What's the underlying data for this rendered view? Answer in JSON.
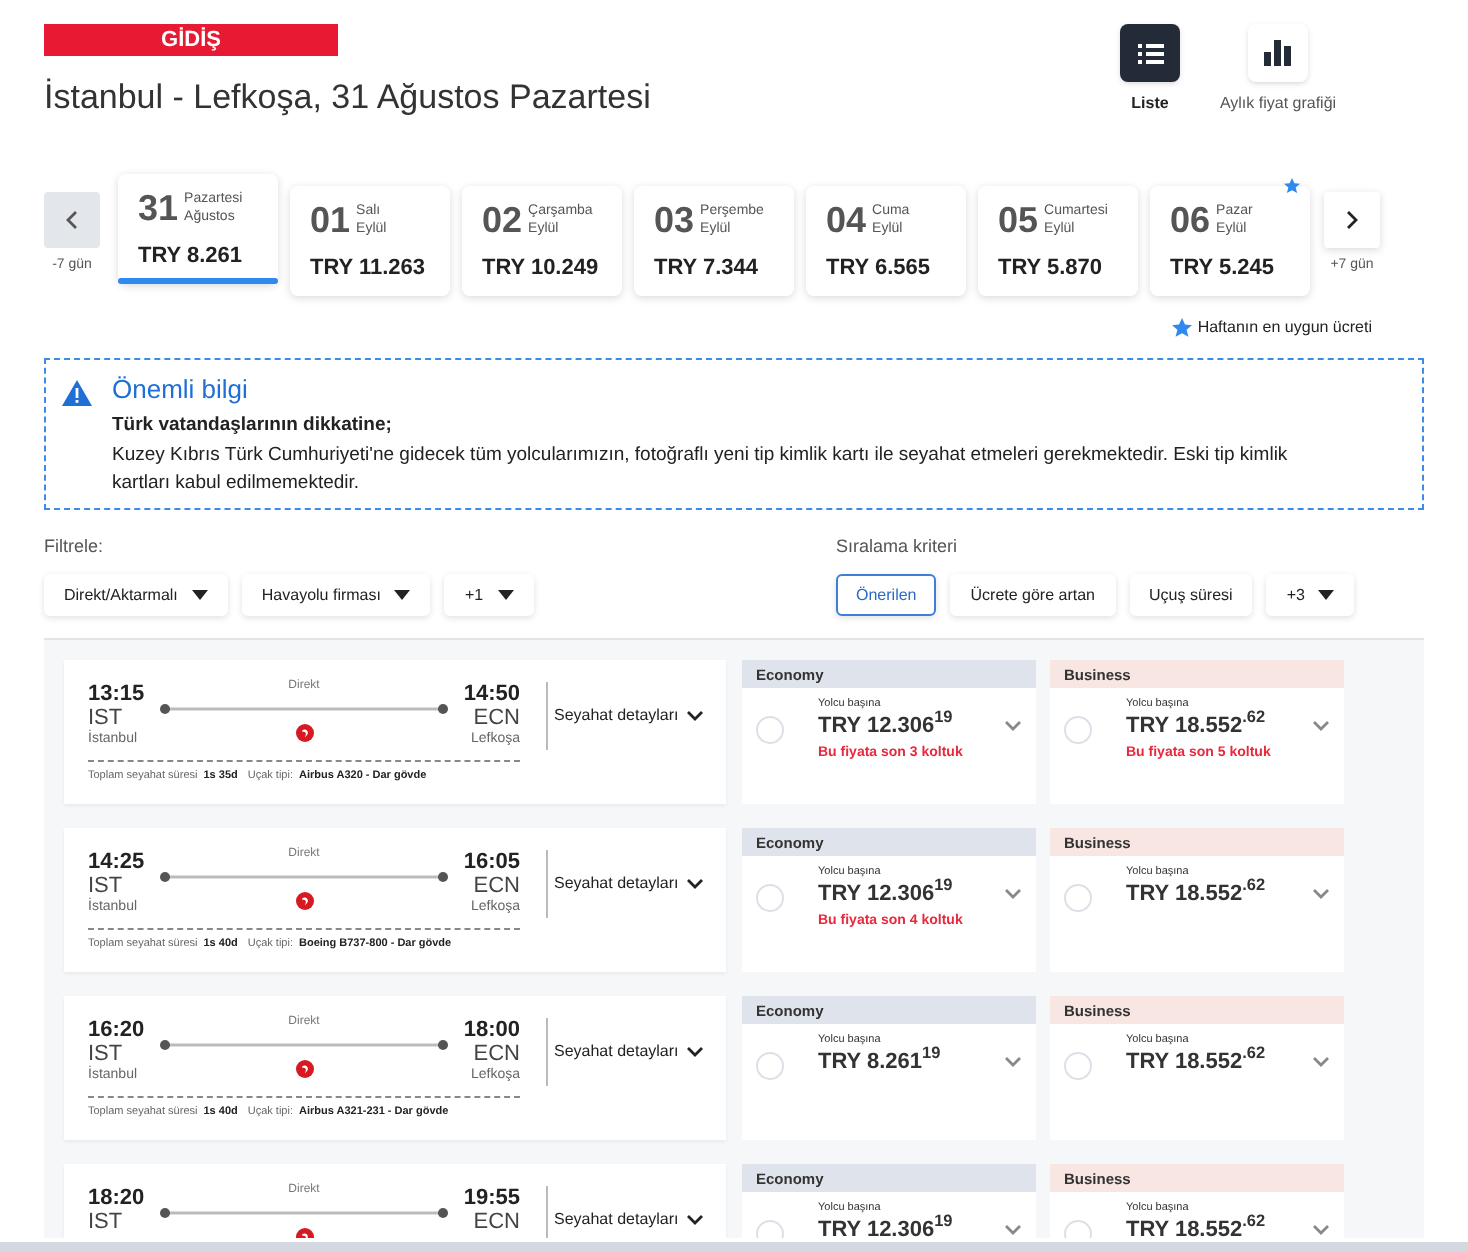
{
  "direction_label": "GİDİŞ",
  "title": "İstanbul - Lefkoşa, 31 Ağustos Pazartesi",
  "view_options": [
    {
      "label": "Liste",
      "kind": "list",
      "selected": true
    },
    {
      "label": "Aylık fiyat grafiği",
      "kind": "chart",
      "selected": false
    }
  ],
  "date_strip": {
    "prev_label": "-7 gün",
    "next_label": "+7 gün",
    "days": [
      {
        "day": "31",
        "weekday": "Pazartesi",
        "month": "Ağustos",
        "price": "TRY 8.261",
        "selected": true,
        "cheapest": false
      },
      {
        "day": "01",
        "weekday": "Salı",
        "month": "Eylül",
        "price": "TRY 11.263",
        "selected": false,
        "cheapest": false
      },
      {
        "day": "02",
        "weekday": "Çarşamba",
        "month": "Eylül",
        "price": "TRY 10.249",
        "selected": false,
        "cheapest": false
      },
      {
        "day": "03",
        "weekday": "Perşembe",
        "month": "Eylül",
        "price": "TRY 7.344",
        "selected": false,
        "cheapest": false
      },
      {
        "day": "04",
        "weekday": "Cuma",
        "month": "Eylül",
        "price": "TRY 6.565",
        "selected": false,
        "cheapest": false
      },
      {
        "day": "05",
        "weekday": "Cumartesi",
        "month": "Eylül",
        "price": "TRY 5.870",
        "selected": false,
        "cheapest": false
      },
      {
        "day": "06",
        "weekday": "Pazar",
        "month": "Eylül",
        "price": "TRY 5.245",
        "selected": false,
        "cheapest": true
      }
    ]
  },
  "cheapest_legend": "Haftanın en uygun ücreti",
  "notice": {
    "title": "Önemli bilgi",
    "subtitle": "Türk vatandaşlarının dikkatine;",
    "text": "Kuzey Kıbrıs Türk Cumhuriyeti'ne gidecek tüm yolcularımızın, fotoğraflı yeni tip kimlik kartı ile seyahat etmeleri gerekmektedir. Eski tip kimlik kartları kabul edilmemektedir."
  },
  "filters": {
    "label": "Filtrele:",
    "options": [
      "Direkt/Aktarmalı",
      "Havayolu firması",
      "+1"
    ]
  },
  "sort": {
    "label": "Sıralama kriteri",
    "options": [
      {
        "label": "Önerilen",
        "kind": "button",
        "selected": true
      },
      {
        "label": "Ücrete göre artan",
        "kind": "button",
        "selected": false
      },
      {
        "label": "Uçuş süresi",
        "kind": "button",
        "selected": false
      },
      {
        "label": "+3",
        "kind": "dropdown",
        "selected": false
      }
    ]
  },
  "flights": [
    {
      "departure_time": "13:15",
      "departure_code": "IST",
      "departure_city": "İstanbul",
      "arrival_time": "14:50",
      "arrival_code": "ECN",
      "arrival_city": "Lefkoşa",
      "stops": "Direkt",
      "details_label": "Seyahat detayları",
      "duration_label": "Toplam seyahat süresi",
      "duration": "1s 35d",
      "aircraft_label": "Uçak tipi:",
      "aircraft": "Airbus A320 - Dar gövde",
      "fares": [
        {
          "cabin": "Economy",
          "kind": "economy",
          "per_person": "Yolcu başına",
          "price": "TRY 12.306$^{19}$",
          "seats_note": "Bu fiyata son 3 koltuk",
          "selected": false
        },
        {
          "cabin": "Business",
          "kind": "business",
          "per_person": "Yolcu başına",
          "price": "TRY 18.552$^{.62}$",
          "seats_note": "Bu fiyata son 5 koltuk",
          "selected": false
        }
      ]
    },
    {
      "departure_time": "14:25",
      "departure_code": "IST",
      "departure_city": "İstanbul",
      "arrival_time": "16:05",
      "arrival_code": "ECN",
      "arrival_city": "Lefkoşa",
      "stops": "Direkt",
      "details_label": "Seyahat detayları",
      "duration_label": "Toplam seyahat süresi",
      "duration": "1s 40d",
      "aircraft_label": "Uçak tipi:",
      "aircraft": "Boeing B737-800 - Dar gövde",
      "fares": [
        {
          "cabin": "Economy",
          "kind": "economy",
          "per_person": "Yolcu başına",
          "price": "TRY 12.306$^{19}$",
          "seats_note": "Bu fiyata son 4 koltuk",
          "selected": false
        },
        {
          "cabin": "Business",
          "kind": "business",
          "per_person": "Yolcu başına",
          "price": "TRY 18.552$^{.62}$",
          "selected": false
        }
      ]
    },
    {
      "departure_time": "16:20",
      "departure_code": "IST",
      "departure_city": "İstanbul",
      "arrival_time": "18:00",
      "arrival_code": "ECN",
      "arrival_city": "Lefkoşa",
      "stops": "Direkt",
      "details_label": "Seyahat detayları",
      "duration_label": "Toplam seyahat süresi",
      "duration": "1s 40d",
      "aircraft_label": "Uçak tipi:",
      "aircraft": "Airbus A321-231 - Dar gövde",
      "fares": [
        {
          "cabin": "Economy",
          "kind": "economy",
          "per_person": "Yolcu başına",
          "price": "TRY 8.261$^{19}$",
          "selected": false
        },
        {
          "cabin": "Business",
          "kind": "business",
          "per_person": "Yolcu başına",
          "price": "TRY 18.552$^{.62}$",
          "selected": false
        }
      ]
    },
    {
      "departure_time": "18:20",
      "departure_code": "IST",
      "arrival_time": "19:55",
      "arrival_code": "ECN",
      "stops": "Direkt",
      "details_label": "Seyahat detayları",
      "fares": [
        {
          "cabin": "Economy",
          "kind": "economy",
          "per_person": "Yolcu başına",
          "price": "TRY 12.306$^{19}$",
          "selected": false
        },
        {
          "cabin": "Business",
          "kind": "business",
          "per_person": "Yolcu başına",
          "price": "TRY 18.552$^{.62}$",
          "selected": false
        }
      ]
    }
  ]
}
